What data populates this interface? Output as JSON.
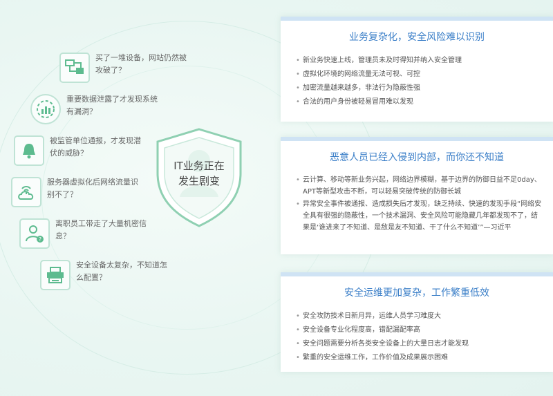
{
  "center": {
    "line1": "IT业务正在",
    "line2": "发生剧变"
  },
  "issues": [
    {
      "text": "买了一堆设备，网站仍然被攻破了？",
      "icon": "network-monitor-icon"
    },
    {
      "text": "重要数据泄露了才发现系统有漏洞？",
      "icon": "chart-gear-icon"
    },
    {
      "text": "被监管单位通报，才发现潜伏的威胁？",
      "icon": "alarm-bell-icon"
    },
    {
      "text": "服务器虚拟化后网络流量识别不了？",
      "icon": "cloud-signal-icon"
    },
    {
      "text": "离职员工带走了大量机密信息？",
      "icon": "user-question-icon"
    },
    {
      "text": "安全设备太复杂，不知道怎么配置？",
      "icon": "printer-device-icon"
    }
  ],
  "cards": [
    {
      "title": "业务复杂化，安全风险难以识别",
      "items": [
        "新业务快速上线，管理员未及时得知并纳入安全管理",
        "虚拟化环境的网络流量无法可视、可控",
        "加密流量越来越多，非法行为隐蔽性强",
        "合法的用户身份被轻易冒用难以发现"
      ]
    },
    {
      "title": "恶意人员已经入侵到内部，而你还不知道",
      "items": [
        "云计算、移动等新业务兴起，网络边界模糊，基于边界的防御日益不足0day、APT等新型攻击不断，可以轻易突破传统的防御长城",
        "异常安全事件被通报、造成损失后才发现，缺乏持续、快速的发现手段“网络安全具有很强的隐蔽性，一个技术漏洞、安全风险可能隐藏几年都发现不了，结果是‘谁进来了不知道、是敌是友不知道、干了什么不知道’”—习近平"
      ]
    },
    {
      "title": "安全运维更加复杂，工作繁重低效",
      "items": [
        "安全攻防技术日新月异，运维人员学习难度大",
        "安全设备专业化程度高，错配漏配率高",
        "安全问题需要分析各类安全设备上的大量日志才能发现",
        "繁重的安全运维工作，工作价值及成果展示困难"
      ]
    }
  ],
  "colors": {
    "accent_green": "#5dbb8f",
    "title_blue": "#3b7fc8",
    "card_bar": "#cfe3f4"
  }
}
